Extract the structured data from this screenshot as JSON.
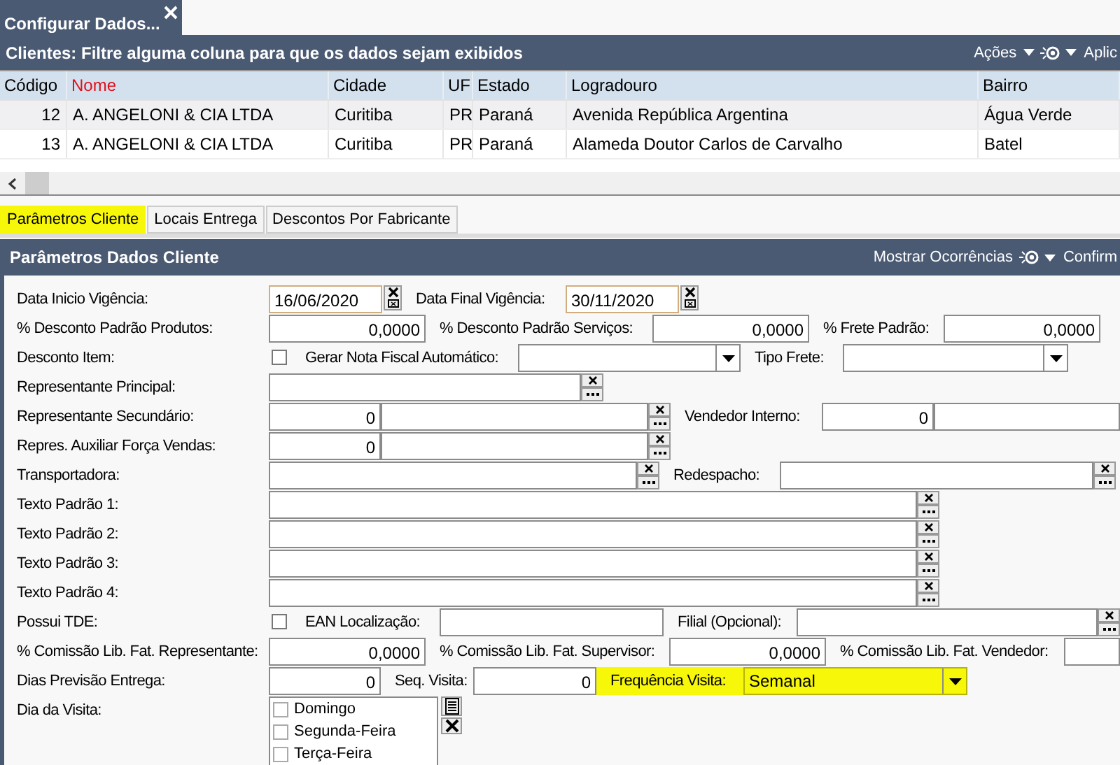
{
  "window": {
    "tab_title": "Configurar Dados..."
  },
  "grid": {
    "title": "Clientes: Filtre alguma coluna para que os dados sejam exibidos",
    "actions": [
      "Ações",
      "Aplic"
    ],
    "columns": [
      {
        "label": "Código",
        "color": "#000000"
      },
      {
        "label": "Nome",
        "color": "#e0101a"
      },
      {
        "label": "Cidade",
        "color": "#000000"
      },
      {
        "label": "UF",
        "color": "#000000"
      },
      {
        "label": "Estado",
        "color": "#000000"
      },
      {
        "label": "Logradouro",
        "color": "#000000"
      },
      {
        "label": "Bairro",
        "color": "#000000"
      }
    ],
    "rows": [
      [
        "12",
        "A. ANGELONI & CIA LTDA",
        "Curitiba",
        "PR",
        "Paraná",
        "Avenida República Argentina",
        "Água Verde"
      ],
      [
        "13",
        "A. ANGELONI & CIA LTDA",
        "Curitiba",
        "PR",
        "Paraná",
        "Alameda Doutor Carlos de Carvalho",
        "Batel"
      ]
    ]
  },
  "tabs": [
    {
      "label": "Parâmetros Cliente",
      "selected": true
    },
    {
      "label": "Locais Entrega",
      "selected": false
    },
    {
      "label": "Descontos Por Fabricante",
      "selected": false
    }
  ],
  "panel": {
    "title": "Parâmetros Dados Cliente",
    "actions": [
      "Mostrar Ocorrências",
      "Confirm"
    ],
    "rows": [
      {
        "label": "Data Inicio Vigência:",
        "items": [
          {
            "kind": "date",
            "value": "16/06/2020"
          },
          {
            "kind": "label",
            "text": "Data Final Vigência:"
          },
          {
            "kind": "date",
            "value": "30/11/2020"
          }
        ]
      },
      {
        "label": "% Desconto Padrão Produtos:",
        "items": [
          {
            "kind": "number",
            "value": "0,0000"
          },
          {
            "kind": "label",
            "text": "% Desconto Padrão Serviços:"
          },
          {
            "kind": "number",
            "value": "0,0000"
          },
          {
            "kind": "label",
            "text": "% Frete Padrão:"
          },
          {
            "kind": "number",
            "value": "0,0000"
          }
        ]
      },
      {
        "label": "Desconto Item:",
        "items": [
          {
            "kind": "checkbox",
            "checked": false
          },
          {
            "kind": "label",
            "text": "Gerar Nota Fiscal Automático:"
          },
          {
            "kind": "combo"
          },
          {
            "kind": "label",
            "text": "Tipo Frete:"
          },
          {
            "kind": "combo"
          }
        ]
      },
      {
        "label": "Representante Principal:",
        "items": [
          {
            "kind": "lookup"
          }
        ]
      },
      {
        "label": "Representante Secundário:",
        "items": [
          {
            "kind": "lookup",
            "code": "0"
          },
          {
            "kind": "label",
            "text": "Vendedor Interno:"
          },
          {
            "kind": "code_field",
            "code": "0"
          }
        ]
      },
      {
        "label": "Repres. Auxiliar Força Vendas:",
        "items": [
          {
            "kind": "lookup",
            "code": "0"
          }
        ]
      },
      {
        "label": "Transportadora:",
        "items": [
          {
            "kind": "lookup"
          },
          {
            "kind": "label",
            "text": "Redespacho:"
          },
          {
            "kind": "lookup"
          }
        ]
      },
      {
        "label": "Texto Padrão 1:",
        "items": [
          {
            "kind": "lookup"
          }
        ]
      },
      {
        "label": "Texto Padrão 2:",
        "items": [
          {
            "kind": "lookup"
          }
        ]
      },
      {
        "label": "Texto Padrão 3:",
        "items": [
          {
            "kind": "lookup"
          }
        ]
      },
      {
        "label": "Texto Padrão 4:",
        "items": [
          {
            "kind": "lookup"
          }
        ]
      },
      {
        "label": "Possui TDE:",
        "items": [
          {
            "kind": "checkbox",
            "checked": false
          },
          {
            "kind": "label",
            "text": "EAN Localização:"
          },
          {
            "kind": "field"
          },
          {
            "kind": "label",
            "text": "Filial (Opcional):"
          },
          {
            "kind": "lookup"
          }
        ]
      },
      {
        "label": "% Comissão Lib. Fat. Representante:",
        "items": [
          {
            "kind": "number",
            "value": "0,0000"
          },
          {
            "kind": "label",
            "text": "% Comissão Lib. Fat. Supervisor:"
          },
          {
            "kind": "number",
            "value": "0,0000"
          },
          {
            "kind": "label",
            "text": "% Comissão Lib. Fat. Vendedor:"
          },
          {
            "kind": "field"
          }
        ]
      },
      {
        "label": "Dias Previsão Entrega:",
        "items": [
          {
            "kind": "number",
            "value": "0"
          },
          {
            "kind": "label",
            "text": "Seq. Visita:"
          },
          {
            "kind": "number",
            "value": "0"
          },
          {
            "kind": "label",
            "text": "Frequência Visita:",
            "highlighted": true
          },
          {
            "kind": "combo",
            "value": "Semanal",
            "highlighted": true
          }
        ]
      },
      {
        "label": "Dia da Visita:",
        "items": [
          {
            "kind": "checklist",
            "options": [
              {
                "label": "Domingo",
                "checked": false
              },
              {
                "label": "Segunda-Feira",
                "checked": false
              },
              {
                "label": "Terça-Feira",
                "checked": false
              }
            ]
          }
        ]
      }
    ]
  }
}
